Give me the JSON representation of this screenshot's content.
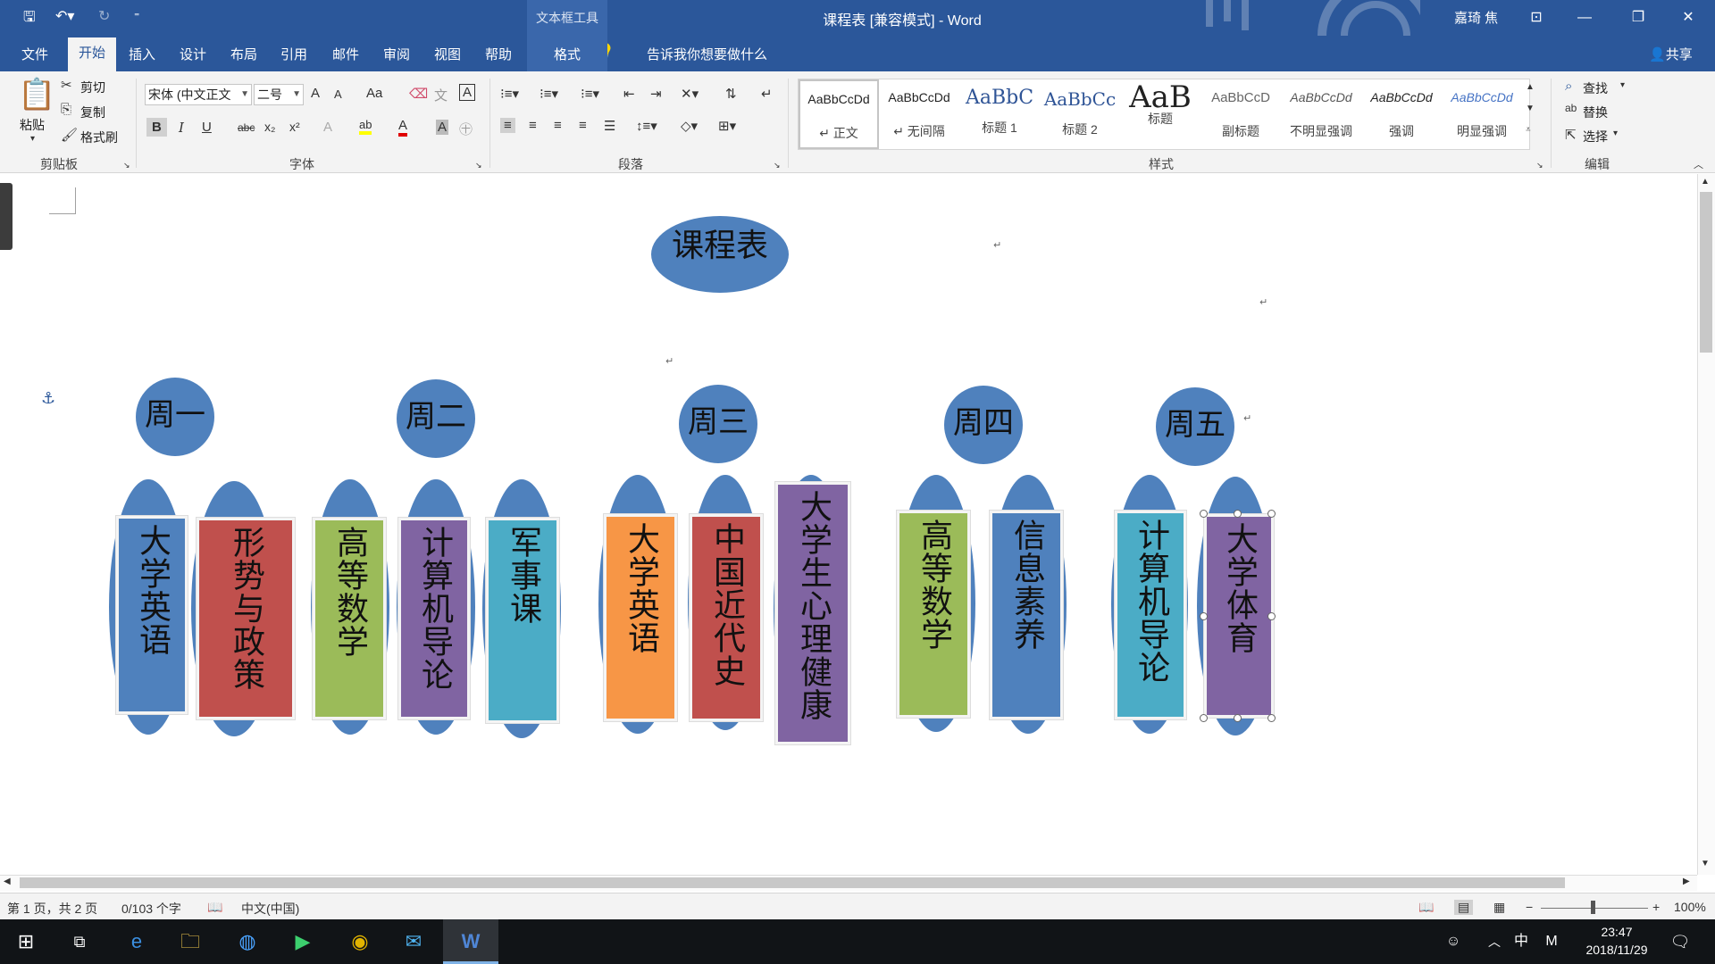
{
  "window": {
    "contextual_tab_group": "文本框工具",
    "document_title": "课程表 [兼容模式] - Word",
    "user_name": "嘉琦 焦",
    "minimize_icon": "—",
    "restore_icon": "❐",
    "close_icon": "✕",
    "ribbon_display_icon": "⊡"
  },
  "ribbon_tabs": {
    "file": "文件",
    "home": "开始",
    "insert": "插入",
    "design": "设计",
    "layout": "布局",
    "references": "引用",
    "mailings": "邮件",
    "review": "审阅",
    "view": "视图",
    "help": "帮助",
    "format": "格式",
    "tell_me": "告诉我你想要做什么",
    "share": "共享"
  },
  "clipboard": {
    "paste": "粘贴",
    "cut": "剪切",
    "copy": "复制",
    "format_painter": "格式刷",
    "group_label": "剪贴板"
  },
  "font": {
    "font_name": "宋体 (中文正文",
    "font_size": "二号",
    "group_label": "字体",
    "grow": "A",
    "shrink": "A",
    "change_case": "Aa",
    "bold": "B",
    "italic": "I",
    "underline": "U",
    "strike": "abc",
    "subscript": "x₂",
    "superscript": "x²",
    "text_effects": "A",
    "font_color": "A",
    "char_shading": "A",
    "enclose": "㊉",
    "char_border": "A"
  },
  "paragraph": {
    "group_label": "段落"
  },
  "styles": {
    "group_label": "样式",
    "items": [
      {
        "sample": "AaBbCcDd",
        "name": "↵ 正文"
      },
      {
        "sample": "AaBbCcDd",
        "name": "↵ 无间隔"
      },
      {
        "sample": "AaBbC",
        "name": "标题 1"
      },
      {
        "sample": "AaBbCc",
        "name": "标题 2"
      },
      {
        "sample": "AaB",
        "name": "标题"
      },
      {
        "sample": "AaBbCcD",
        "name": "副标题"
      },
      {
        "sample": "AaBbCcDd",
        "name": "不明显强调"
      },
      {
        "sample": "AaBbCcDd",
        "name": "强调"
      },
      {
        "sample": "AaBbCcDd",
        "name": "明显强调"
      }
    ]
  },
  "editing": {
    "find": "查找",
    "replace": "替换",
    "select": "选择",
    "group_label": "编辑"
  },
  "document": {
    "title": "课程表",
    "days": [
      {
        "label": "周一",
        "courses": [
          {
            "text": "大学英语",
            "color": "#4f81bd"
          },
          {
            "text": "形势与政策",
            "color": "#c0504d"
          }
        ]
      },
      {
        "label": "周二",
        "courses": [
          {
            "text": "高等数学",
            "color": "#9bbb59"
          },
          {
            "text": "计算机导论",
            "color": "#8064a2"
          },
          {
            "text": "军事课",
            "color": "#4bacc6"
          }
        ]
      },
      {
        "label": "周三",
        "courses": [
          {
            "text": "大学英语",
            "color": "#f79646"
          },
          {
            "text": "中国近代史",
            "color": "#c0504d"
          },
          {
            "text": "大学生心理健康",
            "color": "#8064a2"
          }
        ]
      },
      {
        "label": "周四",
        "courses": [
          {
            "text": "高等数学",
            "color": "#9bbb59"
          },
          {
            "text": "信息素养",
            "color": "#4f81bd"
          }
        ]
      },
      {
        "label": "周五",
        "courses": [
          {
            "text": "计算机导论",
            "color": "#4bacc6"
          },
          {
            "text": "大学体育",
            "color": "#8064a2"
          }
        ]
      }
    ],
    "paragraph_mark": "↵",
    "anchor_icon": "⚓"
  },
  "status": {
    "page": "第 1 页，共 2 页",
    "words": "0/103 个字",
    "language": "中文(中国)",
    "zoom": "100%",
    "zoom_level": 1.0
  },
  "taskbar": {
    "time": "23:47",
    "date": "2018/11/29",
    "ime": "中",
    "ime_mode": "M"
  }
}
